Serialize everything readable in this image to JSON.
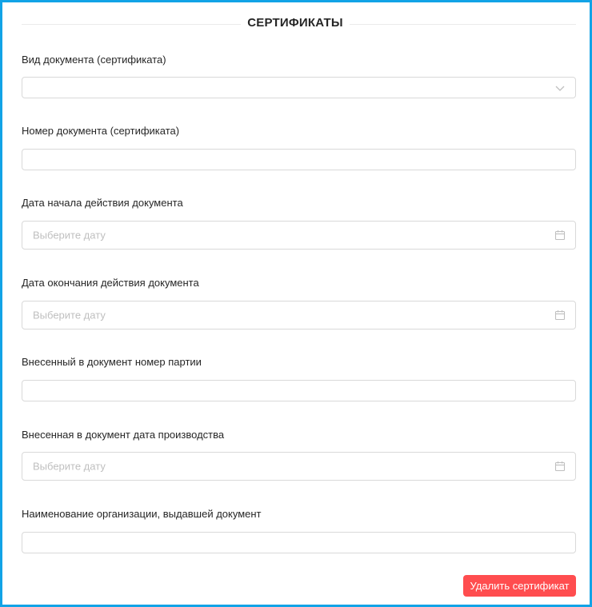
{
  "section": {
    "title": "СЕРТИФИКАТЫ"
  },
  "fields": [
    {
      "label": "Вид документа (сертификата)",
      "value": "",
      "icon": "chevron-down-icon"
    },
    {
      "label": "Номер документа (сертификата)",
      "value": ""
    },
    {
      "label": "Дата начала действия документа",
      "placeholder": "Выберите дату",
      "icon": "calendar-icon"
    },
    {
      "label": "Дата окончания действия документа",
      "placeholder": "Выберите дату",
      "icon": "calendar-icon"
    },
    {
      "label": "Внесенный в документ номер партии",
      "value": ""
    },
    {
      "label": "Внесенная в документ дата производства",
      "placeholder": "Выберите дату",
      "icon": "calendar-icon"
    },
    {
      "label": "Наименование организации, выдавшей документ",
      "value": ""
    }
  ],
  "actions": {
    "delete_label": "Удалить сертификат"
  },
  "colors": {
    "frame": "#12a3e6",
    "danger": "#ff4d4f",
    "border": "#d9d9d9",
    "placeholder": "#bfbfbf"
  }
}
